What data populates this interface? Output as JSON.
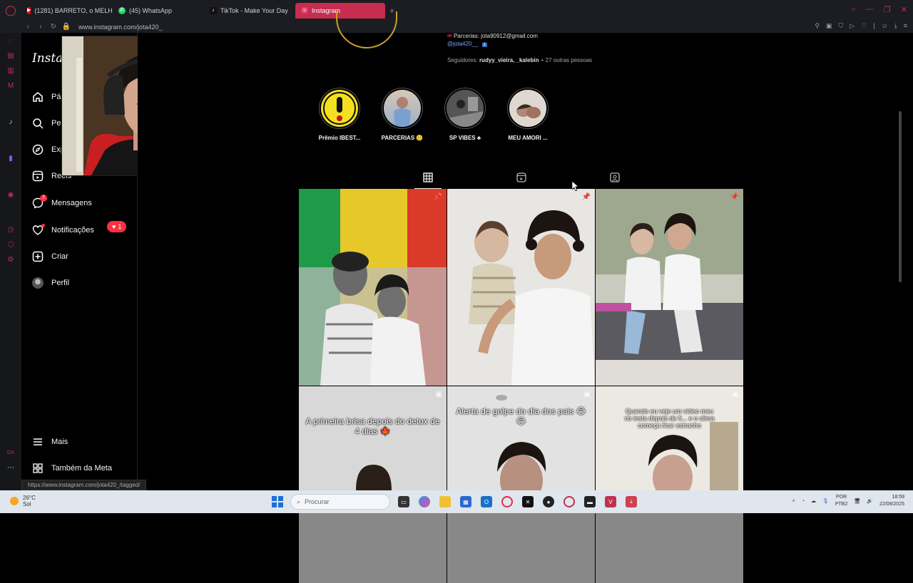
{
  "browser": {
    "tabs": [
      {
        "label": "(1281) BARRETO, o MELH",
        "icon": "youtube-icon",
        "color": "#ff0000"
      },
      {
        "label": "(45) WhatsApp",
        "icon": "whatsapp-icon",
        "color": "#25d366"
      },
      {
        "label": "TikTok - Make Your Day",
        "icon": "tiktok-icon",
        "color": "#111111"
      },
      {
        "label": "Instagram",
        "icon": "instagram-icon",
        "color": "#e1306c",
        "active": true
      }
    ],
    "url": "www.instagram.com/jota420_",
    "status_url": "https://www.instagram.com/jota420_/tagged/"
  },
  "sidebar": {
    "logo": "Instag",
    "items": [
      {
        "label": "Pág",
        "icon": "home-icon"
      },
      {
        "label": "Pes",
        "icon": "search-icon"
      },
      {
        "label": "Exp",
        "icon": "explore-icon"
      },
      {
        "label": "Reels",
        "icon": "reels-icon"
      },
      {
        "label": "Mensagens",
        "icon": "messenger-icon",
        "badge": "7"
      },
      {
        "label": "Notificações",
        "icon": "heart-icon",
        "pill": "1"
      },
      {
        "label": "Criar",
        "icon": "plus-icon"
      },
      {
        "label": "Perfil",
        "icon": "avatar"
      }
    ],
    "more": "Mais",
    "meta": "Também da Meta"
  },
  "profile": {
    "email_line": "Parcerias: jota90912@gmail.com",
    "handle": "@jota420__",
    "followers_prefix": "Seguidores:",
    "followers_names": "rudyy_vieira, _kalebin",
    "followers_suffix": "+ 27 outras pessoas"
  },
  "highlights": [
    {
      "label": "Prêmio IBEST..."
    },
    {
      "label": "PARCERIAS 🙂"
    },
    {
      "label": "SP VIBES ♣"
    },
    {
      "label": "MEU AMORI ..."
    }
  ],
  "posts": [
    {
      "caption": "",
      "icon": "pin-icon"
    },
    {
      "caption": "",
      "icon": "pin-icon"
    },
    {
      "caption": "",
      "icon": "pin-icon"
    },
    {
      "caption": "A primeira brisa depois do detox de 4 dias 🍁",
      "icon": "reel-icon"
    },
    {
      "caption": "Alerta de golpe do dia dos pais 😂😂",
      "icon": "reel-icon"
    },
    {
      "caption": "Quando eu vejo um vídeo meu no insta depois de fi... e o clima começa ficar estranho",
      "icon": "reel-icon"
    }
  ],
  "taskbar": {
    "temp": "26°C",
    "weather": "Sol",
    "search_placeholder": "Procurar",
    "lang": "POR",
    "layout": "PTB2",
    "time": "18:59",
    "date": "22/08/2025"
  },
  "colors": {
    "accent": "#c62d4f",
    "notif": "#ff3040"
  }
}
